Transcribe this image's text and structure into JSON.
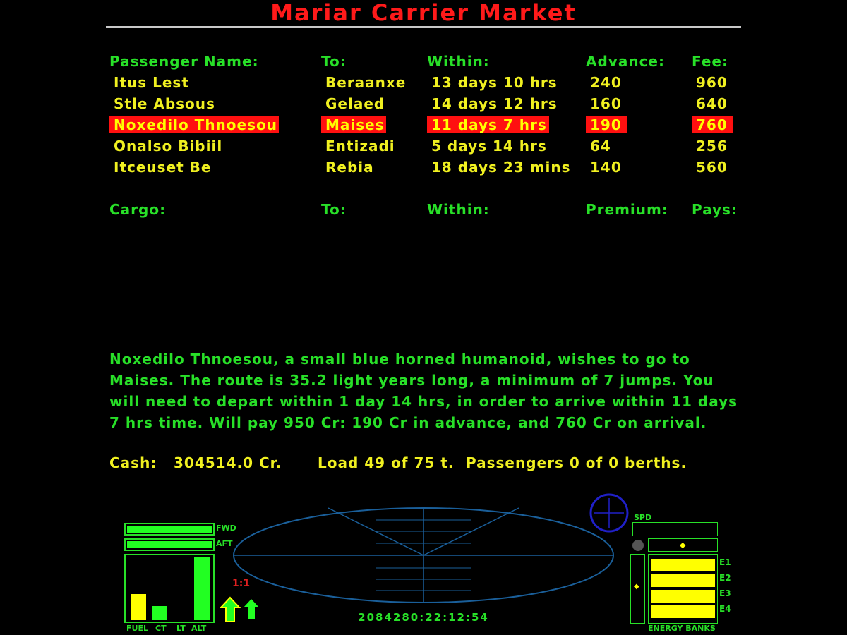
{
  "title": "Mariar Carrier Market",
  "passenger_headers": {
    "name": "Passenger Name:",
    "to": "To:",
    "within": "Within:",
    "advance": "Advance:",
    "fee": "Fee:"
  },
  "passengers": [
    {
      "name": "Itus Lest",
      "to": "Beraanxe",
      "within": "13 days 10 hrs",
      "advance": "240",
      "fee": "960",
      "selected": false
    },
    {
      "name": "Stle Absous",
      "to": "Gelaed",
      "within": "14 days 12 hrs",
      "advance": "160",
      "fee": "640",
      "selected": false
    },
    {
      "name": "Noxedilo Thnoesou",
      "to": "Maises",
      "within": "11 days 7 hrs",
      "advance": "190",
      "fee": "760",
      "selected": true
    },
    {
      "name": "Onalso Bibiil",
      "to": "Entizadi",
      "within": "5 days 14 hrs",
      "advance": "64",
      "fee": "256",
      "selected": false
    },
    {
      "name": "Itceuset Be",
      "to": "Rebia",
      "within": "18 days 23 mins",
      "advance": "140",
      "fee": "560",
      "selected": false
    }
  ],
  "cargo_headers": {
    "cargo": "Cargo:",
    "to": "To:",
    "within": "Within:",
    "premium": "Premium:",
    "pays": "Pays:"
  },
  "description": "Noxedilo Thnoesou, a small blue horned humanoid, wishes to go to Maises. The route is 35.2 light years long, a minimum of 7 jumps. You will need to depart within 1 day 14 hrs, in order to arrive within 11 days 7 hrs time. Will pay 950 Cr: 190 Cr in advance, and 760 Cr on arrival.",
  "status": {
    "cash_label": "Cash:",
    "cash_value": "304514.0 Cr.",
    "load": "Load 49 of 75 t.",
    "passengers": "Passengers 0 of 0 berths."
  },
  "hud": {
    "fwd": "FWD",
    "aft": "AFT",
    "gauges": {
      "fuel": "FUEL",
      "ct": "CT",
      "lt": "LT",
      "alt": "ALT"
    },
    "gauge_levels": {
      "fuel": 0.4,
      "ct": 0.22,
      "lt": 0.0,
      "alt": 0.97
    },
    "time_accel": "1:1",
    "clock": "2084280:22:12:54",
    "spd": "SPD",
    "energy_banks": "ENERGY BANKS",
    "banks": [
      "E1",
      "E2",
      "E3",
      "E4"
    ],
    "colors": {
      "green": "#28e028",
      "yellow": "#f0f020",
      "red": "#ff1a1a",
      "scanner": "#1a5f9a",
      "compass": "#2020c8"
    }
  }
}
